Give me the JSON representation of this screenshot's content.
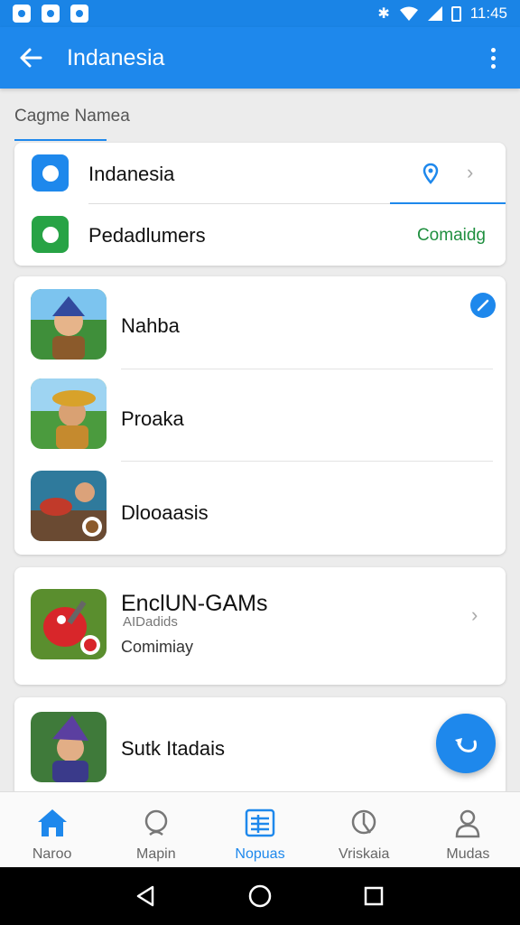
{
  "status_bar": {
    "time": "11:45",
    "icons": [
      "image-icon",
      "whatsapp-icon",
      "message-icon",
      "bluetooth-icon",
      "wifi-icon",
      "signal-icon",
      "battery-icon"
    ]
  },
  "app_bar": {
    "title": "Indanesia",
    "back_icon": "arrow-left-icon",
    "menu_icon": "more-vertical-icon"
  },
  "section": {
    "label": "Cagme Namea"
  },
  "settings": [
    {
      "label": "Indanesia",
      "icon": "app-blue-icon",
      "trailing": "location-pin-icon"
    },
    {
      "label": "Pedadlumers",
      "icon": "app-green-icon",
      "status": "Comaidg"
    }
  ],
  "games": [
    {
      "name": "Nahba",
      "badge": "check-icon"
    },
    {
      "name": "Proaka"
    },
    {
      "name": "Dlooaasis"
    }
  ],
  "featured": {
    "title": "EnclUN-GAMs",
    "ghost": "AIDadids",
    "subtitle": "Comimiay"
  },
  "last_item": {
    "name": "Sutk Itadais"
  },
  "bottom_nav": [
    {
      "label": "Naroo",
      "icon": "home-icon"
    },
    {
      "label": "Mapin",
      "icon": "search-icon"
    },
    {
      "label": "Nopuas",
      "icon": "list-icon",
      "active": true
    },
    {
      "label": "Vriskaia",
      "icon": "compass-icon"
    },
    {
      "label": "Mudas",
      "icon": "profile-icon"
    }
  ],
  "colors": {
    "primary": "#1e88ec",
    "status_green": "#1f8f3f",
    "background": "#ececec"
  }
}
